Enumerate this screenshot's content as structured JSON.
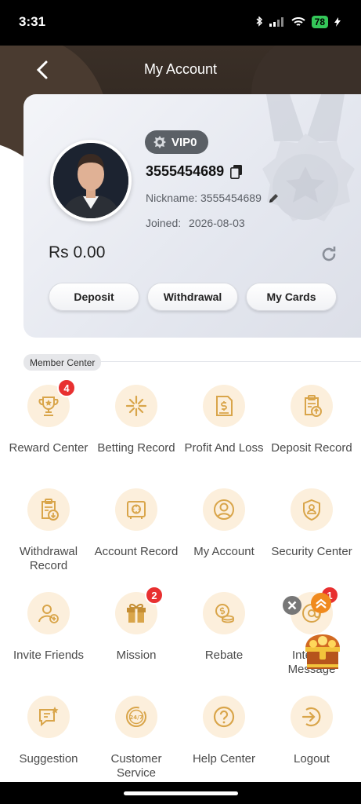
{
  "status_bar": {
    "time": "3:31",
    "battery": "78"
  },
  "header": {
    "title": "My Account"
  },
  "profile": {
    "vip_level": "VIP0",
    "account_id": "3555454689",
    "nickname_label": "Nickname: 3555454689",
    "joined_label": "Joined:",
    "joined_date": "2026-08-03",
    "balance": "Rs 0.00"
  },
  "actions": {
    "deposit": "Deposit",
    "withdrawal": "Withdrawal",
    "my_cards": "My Cards"
  },
  "member_center": {
    "title": "Member Center",
    "items": [
      {
        "label": "Reward Center",
        "icon": "trophy-icon",
        "badge": "4"
      },
      {
        "label": "Betting Record",
        "icon": "betting-icon"
      },
      {
        "label": "Profit And Loss",
        "icon": "document-money-icon"
      },
      {
        "label": "Deposit Record",
        "icon": "clipboard-upload-icon"
      },
      {
        "label": "Withdrawal Record",
        "icon": "clipboard-download-icon"
      },
      {
        "label": "Account Record",
        "icon": "safe-icon"
      },
      {
        "label": "My Account",
        "icon": "user-icon"
      },
      {
        "label": "Security Center",
        "icon": "shield-user-icon"
      },
      {
        "label": "Invite Friends",
        "icon": "invite-user-icon"
      },
      {
        "label": "Mission",
        "icon": "gift-icon",
        "badge": "2"
      },
      {
        "label": "Rebate",
        "icon": "coins-icon"
      },
      {
        "label": "Internal Message",
        "icon": "message-icon",
        "badge": "1"
      },
      {
        "label": "Suggestion",
        "icon": "chat-star-icon"
      },
      {
        "label": "Customer Service",
        "icon": "support-24-7-icon"
      },
      {
        "label": "Help Center",
        "icon": "help-icon"
      },
      {
        "label": "Logout",
        "icon": "logout-icon"
      }
    ]
  },
  "colors": {
    "accent": "#d9a54a",
    "icon_bg": "#fcefdc",
    "badge": "#e83030",
    "header_bg": "#2b231d"
  }
}
